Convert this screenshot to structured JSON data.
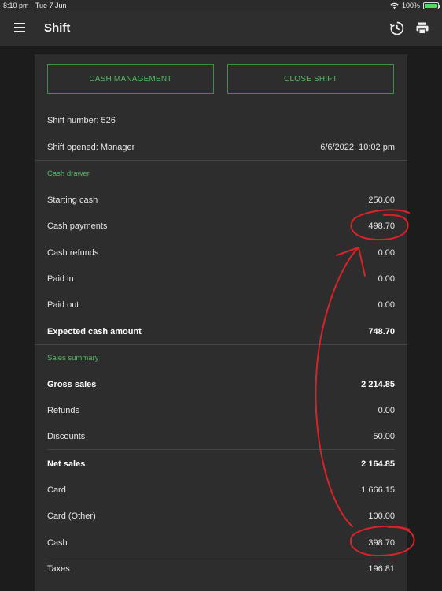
{
  "status_bar": {
    "time": "8:10 pm",
    "date": "Tue 7 Jun",
    "battery": "100%"
  },
  "app_bar": {
    "title": "Shift"
  },
  "buttons": {
    "cash_management": "CASH MANAGEMENT",
    "close_shift": "CLOSE SHIFT"
  },
  "shift": {
    "number": "Shift number: 526",
    "opened": "Shift opened: Manager",
    "opened_at": "6/6/2022, 10:02 pm"
  },
  "cash_drawer": {
    "label": "Cash drawer",
    "rows": [
      {
        "label": "Starting cash",
        "value": "250.00"
      },
      {
        "label": "Cash payments",
        "value": "498.70"
      },
      {
        "label": "Cash refunds",
        "value": "0.00"
      },
      {
        "label": "Paid in",
        "value": "0.00"
      },
      {
        "label": "Paid out",
        "value": "0.00"
      },
      {
        "label": "Expected cash amount",
        "value": "748.70"
      }
    ]
  },
  "sales_summary": {
    "label": "Sales summary",
    "rows": [
      {
        "label": "Gross sales",
        "value": "2 214.85"
      },
      {
        "label": "Refunds",
        "value": "0.00"
      },
      {
        "label": "Discounts",
        "value": "50.00"
      },
      {
        "label": "Net sales",
        "value": "2 164.85"
      },
      {
        "label": "Card",
        "value": "1 666.15"
      },
      {
        "label": "Card (Other)",
        "value": "100.00"
      },
      {
        "label": "Cash",
        "value": "398.70"
      },
      {
        "label": "Taxes",
        "value": "196.81"
      }
    ]
  },
  "colors": {
    "accent": "#57b865",
    "annotation": "#d8232a",
    "background": "#1c1c1c",
    "card": "#2d2d2d"
  },
  "icons": [
    "menu-icon",
    "history-icon",
    "print-icon",
    "wifi-icon",
    "battery-icon"
  ]
}
